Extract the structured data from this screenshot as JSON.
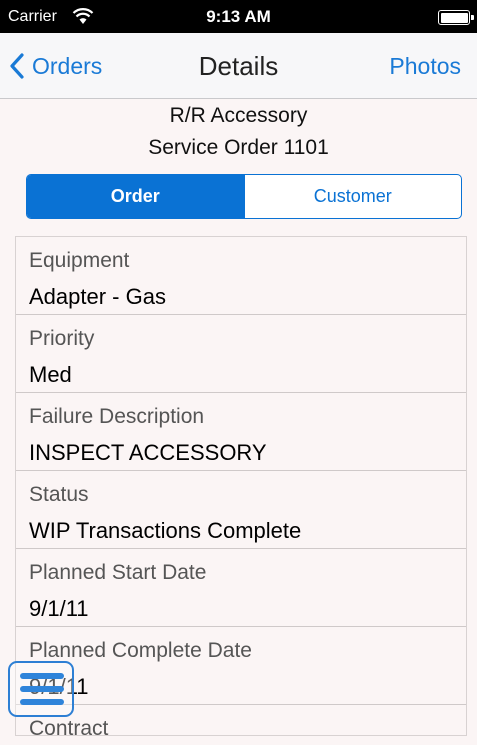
{
  "status_bar": {
    "carrier": "Carrier",
    "time": "9:13 AM"
  },
  "nav": {
    "back_label": "Orders",
    "title": "Details",
    "right_label": "Photos"
  },
  "header": {
    "line1": "R/R Accessory",
    "line2": "Service Order 1101"
  },
  "segments": {
    "order": "Order",
    "customer": "Customer",
    "selected": "Order"
  },
  "fields": [
    {
      "label": "Equipment",
      "value": "Adapter - Gas"
    },
    {
      "label": "Priority",
      "value": "Med"
    },
    {
      "label": "Failure Description",
      "value": "INSPECT ACCESSORY"
    },
    {
      "label": "Status",
      "value": "WIP Transactions Complete"
    },
    {
      "label": "Planned Start Date",
      "value": "9/1/11"
    },
    {
      "label": "Planned Complete Date",
      "value": "9/1/11"
    },
    {
      "label": "Contract",
      "value": ""
    }
  ],
  "colors": {
    "accent": "#0a72d4",
    "background": "#fbf5f5"
  }
}
